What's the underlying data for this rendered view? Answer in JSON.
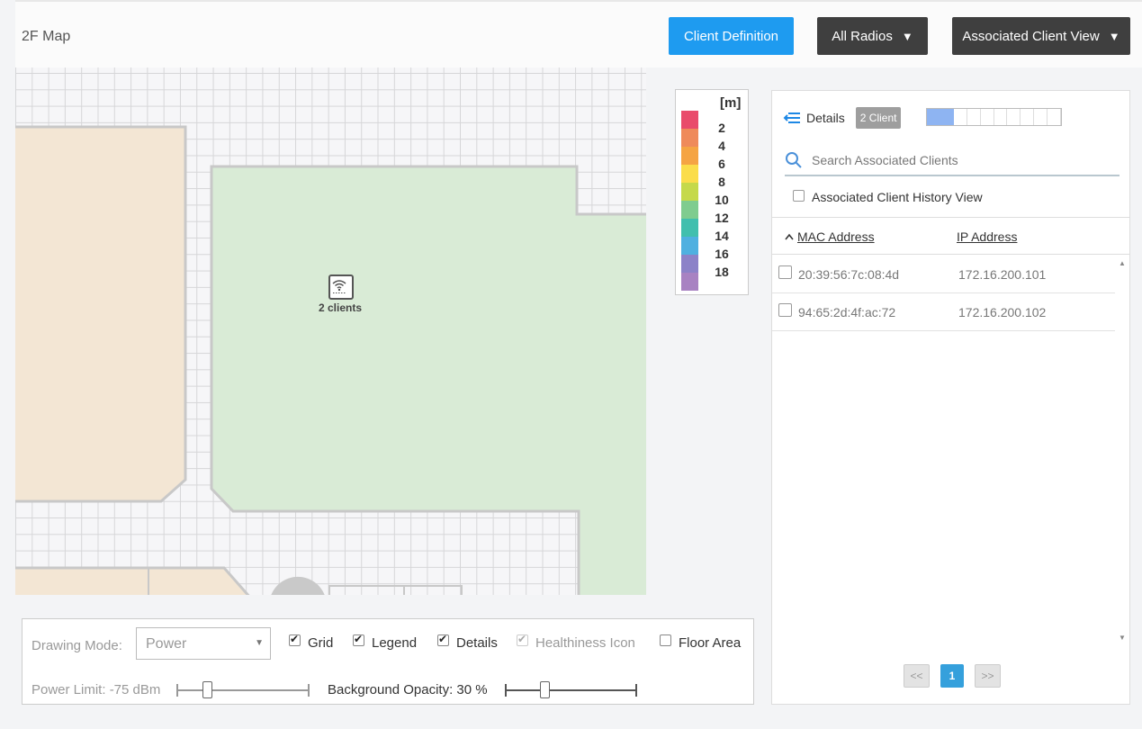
{
  "header": {
    "map_title": "2F Map",
    "client_definition_label": "Client Definition",
    "radios_label": "All Radios",
    "view_label": "Associated Client View"
  },
  "map": {
    "ap_label": "2 clients"
  },
  "legend": {
    "unit": "[m]",
    "entries": [
      {
        "label": "2",
        "color": "#e94b6b"
      },
      {
        "label": "4",
        "color": "#ef8a5a"
      },
      {
        "label": "6",
        "color": "#f5a443"
      },
      {
        "label": "8",
        "color": "#fbdd4a"
      },
      {
        "label": "10",
        "color": "#c5d94a"
      },
      {
        "label": "12",
        "color": "#7fcc8f"
      },
      {
        "label": "14",
        "color": "#41bfae"
      },
      {
        "label": "16",
        "color": "#4fb0e0"
      },
      {
        "label": "18",
        "color": "#8c82c8"
      },
      {
        "label": "",
        "color": "#a882c2"
      }
    ]
  },
  "details": {
    "title": "Details",
    "client_badge": "2 Client",
    "meter_filled": 0.2,
    "search_placeholder": "Search Associated Clients",
    "history_label": "Associated Client History View",
    "col_mac": "MAC Address",
    "col_ip": "IP Address",
    "rows": [
      {
        "mac": "20:39:56:7c:08:4d",
        "ip": "172.16.200.101"
      },
      {
        "mac": "94:65:2d:4f:ac:72",
        "ip": "172.16.200.102"
      }
    ],
    "pager": {
      "prev": "<<",
      "page": "1",
      "next": ">>"
    }
  },
  "controls": {
    "drawing_mode_label": "Drawing Mode:",
    "drawing_mode_value": "Power",
    "grid_label": "Grid",
    "legend_label": "Legend",
    "details_label": "Details",
    "healthiness_label": "Healthiness Icon",
    "floor_area_label": "Floor Area",
    "power_limit_label": "Power Limit: -75 dBm",
    "power_limit_value": 0.23,
    "opacity_label": "Background Opacity: 30 %",
    "opacity_value": 0.3
  }
}
